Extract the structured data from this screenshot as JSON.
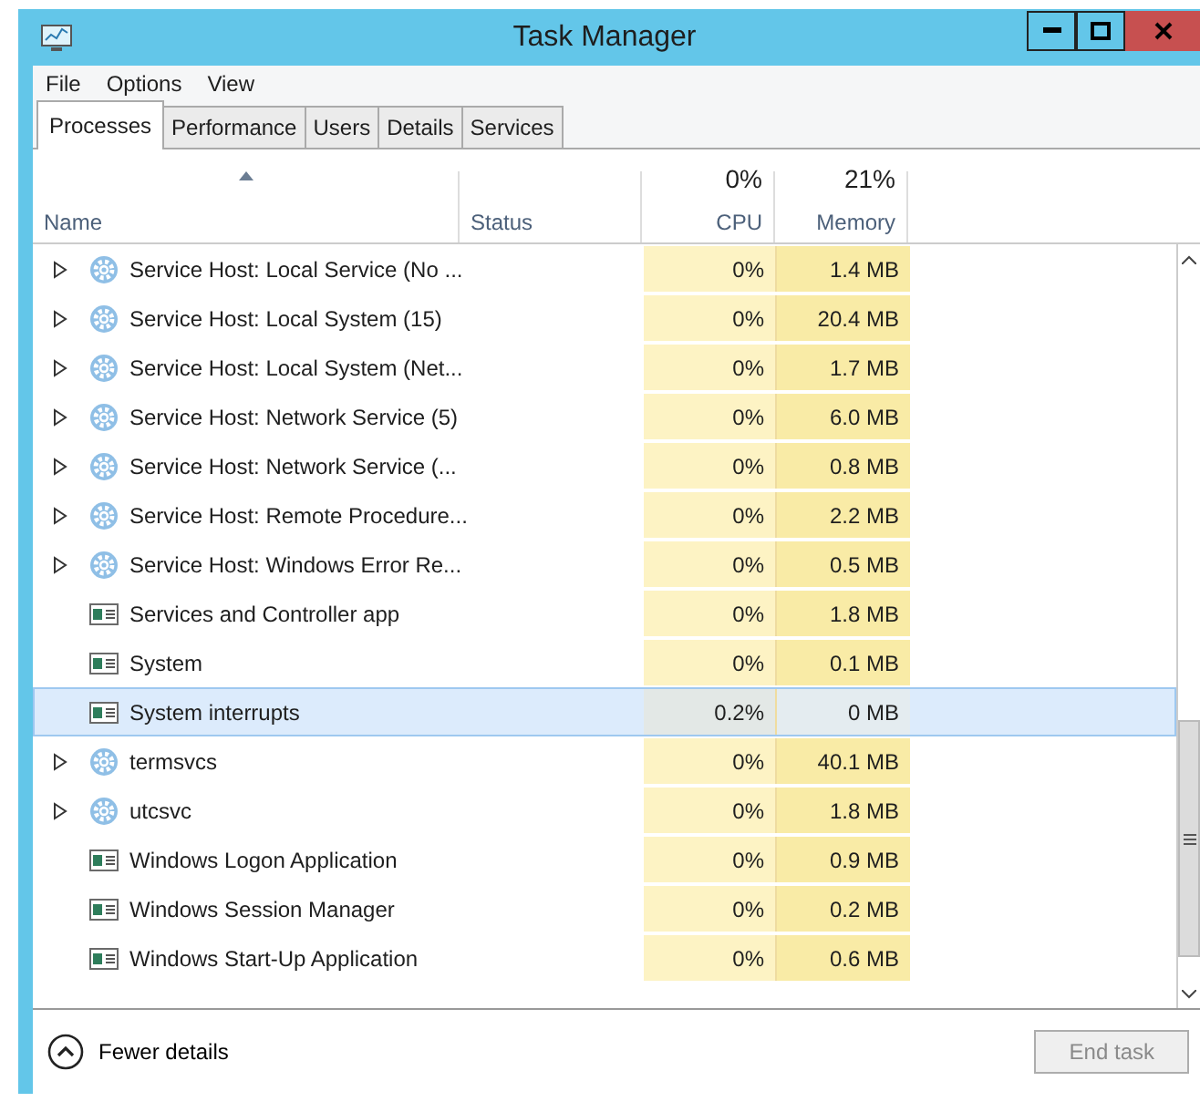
{
  "window": {
    "title": "Task Manager"
  },
  "menu": [
    "File",
    "Options",
    "View"
  ],
  "tabs": [
    {
      "label": "Processes",
      "selected": true
    },
    {
      "label": "Performance",
      "selected": false
    },
    {
      "label": "Users",
      "selected": false
    },
    {
      "label": "Details",
      "selected": false
    },
    {
      "label": "Services",
      "selected": false
    }
  ],
  "table": {
    "columns": [
      {
        "label": "Name"
      },
      {
        "label": "Status"
      },
      {
        "label": "CPU",
        "total": "0%"
      },
      {
        "label": "Memory",
        "total": "21%"
      }
    ],
    "rows": [
      {
        "kind": "service",
        "name": "Service Host: Local Service (No ...",
        "cpu": "0%",
        "memory": "1.4 MB",
        "selected": false
      },
      {
        "kind": "service",
        "name": "Service Host: Local System (15)",
        "cpu": "0%",
        "memory": "20.4 MB",
        "selected": false
      },
      {
        "kind": "service",
        "name": "Service Host: Local System (Net...",
        "cpu": "0%",
        "memory": "1.7 MB",
        "selected": false
      },
      {
        "kind": "service",
        "name": "Service Host: Network Service (5)",
        "cpu": "0%",
        "memory": "6.0 MB",
        "selected": false
      },
      {
        "kind": "service",
        "name": "Service Host: Network Service (...",
        "cpu": "0%",
        "memory": "0.8 MB",
        "selected": false
      },
      {
        "kind": "service",
        "name": "Service Host: Remote Procedure...",
        "cpu": "0%",
        "memory": "2.2 MB",
        "selected": false
      },
      {
        "kind": "service",
        "name": "Service Host: Windows Error Re...",
        "cpu": "0%",
        "memory": "0.5 MB",
        "selected": false
      },
      {
        "kind": "app",
        "name": "Services and Controller app",
        "cpu": "0%",
        "memory": "1.8 MB",
        "selected": false
      },
      {
        "kind": "app",
        "name": "System",
        "cpu": "0%",
        "memory": "0.1 MB",
        "selected": false
      },
      {
        "kind": "app",
        "name": "System interrupts",
        "cpu": "0.2%",
        "memory": "0 MB",
        "selected": true
      },
      {
        "kind": "service",
        "name": "termsvcs",
        "cpu": "0%",
        "memory": "40.1 MB",
        "selected": false
      },
      {
        "kind": "service",
        "name": "utcsvc",
        "cpu": "0%",
        "memory": "1.8 MB",
        "selected": false
      },
      {
        "kind": "app",
        "name": "Windows Logon Application",
        "cpu": "0%",
        "memory": "0.9 MB",
        "selected": false
      },
      {
        "kind": "app",
        "name": "Windows Session Manager",
        "cpu": "0%",
        "memory": "0.2 MB",
        "selected": false
      },
      {
        "kind": "app",
        "name": "Windows Start-Up Application",
        "cpu": "0%",
        "memory": "0.6 MB",
        "selected": false
      }
    ]
  },
  "footer": {
    "details_label": "Fewer details",
    "end_task": {
      "label": "End task",
      "disabled": true
    }
  }
}
